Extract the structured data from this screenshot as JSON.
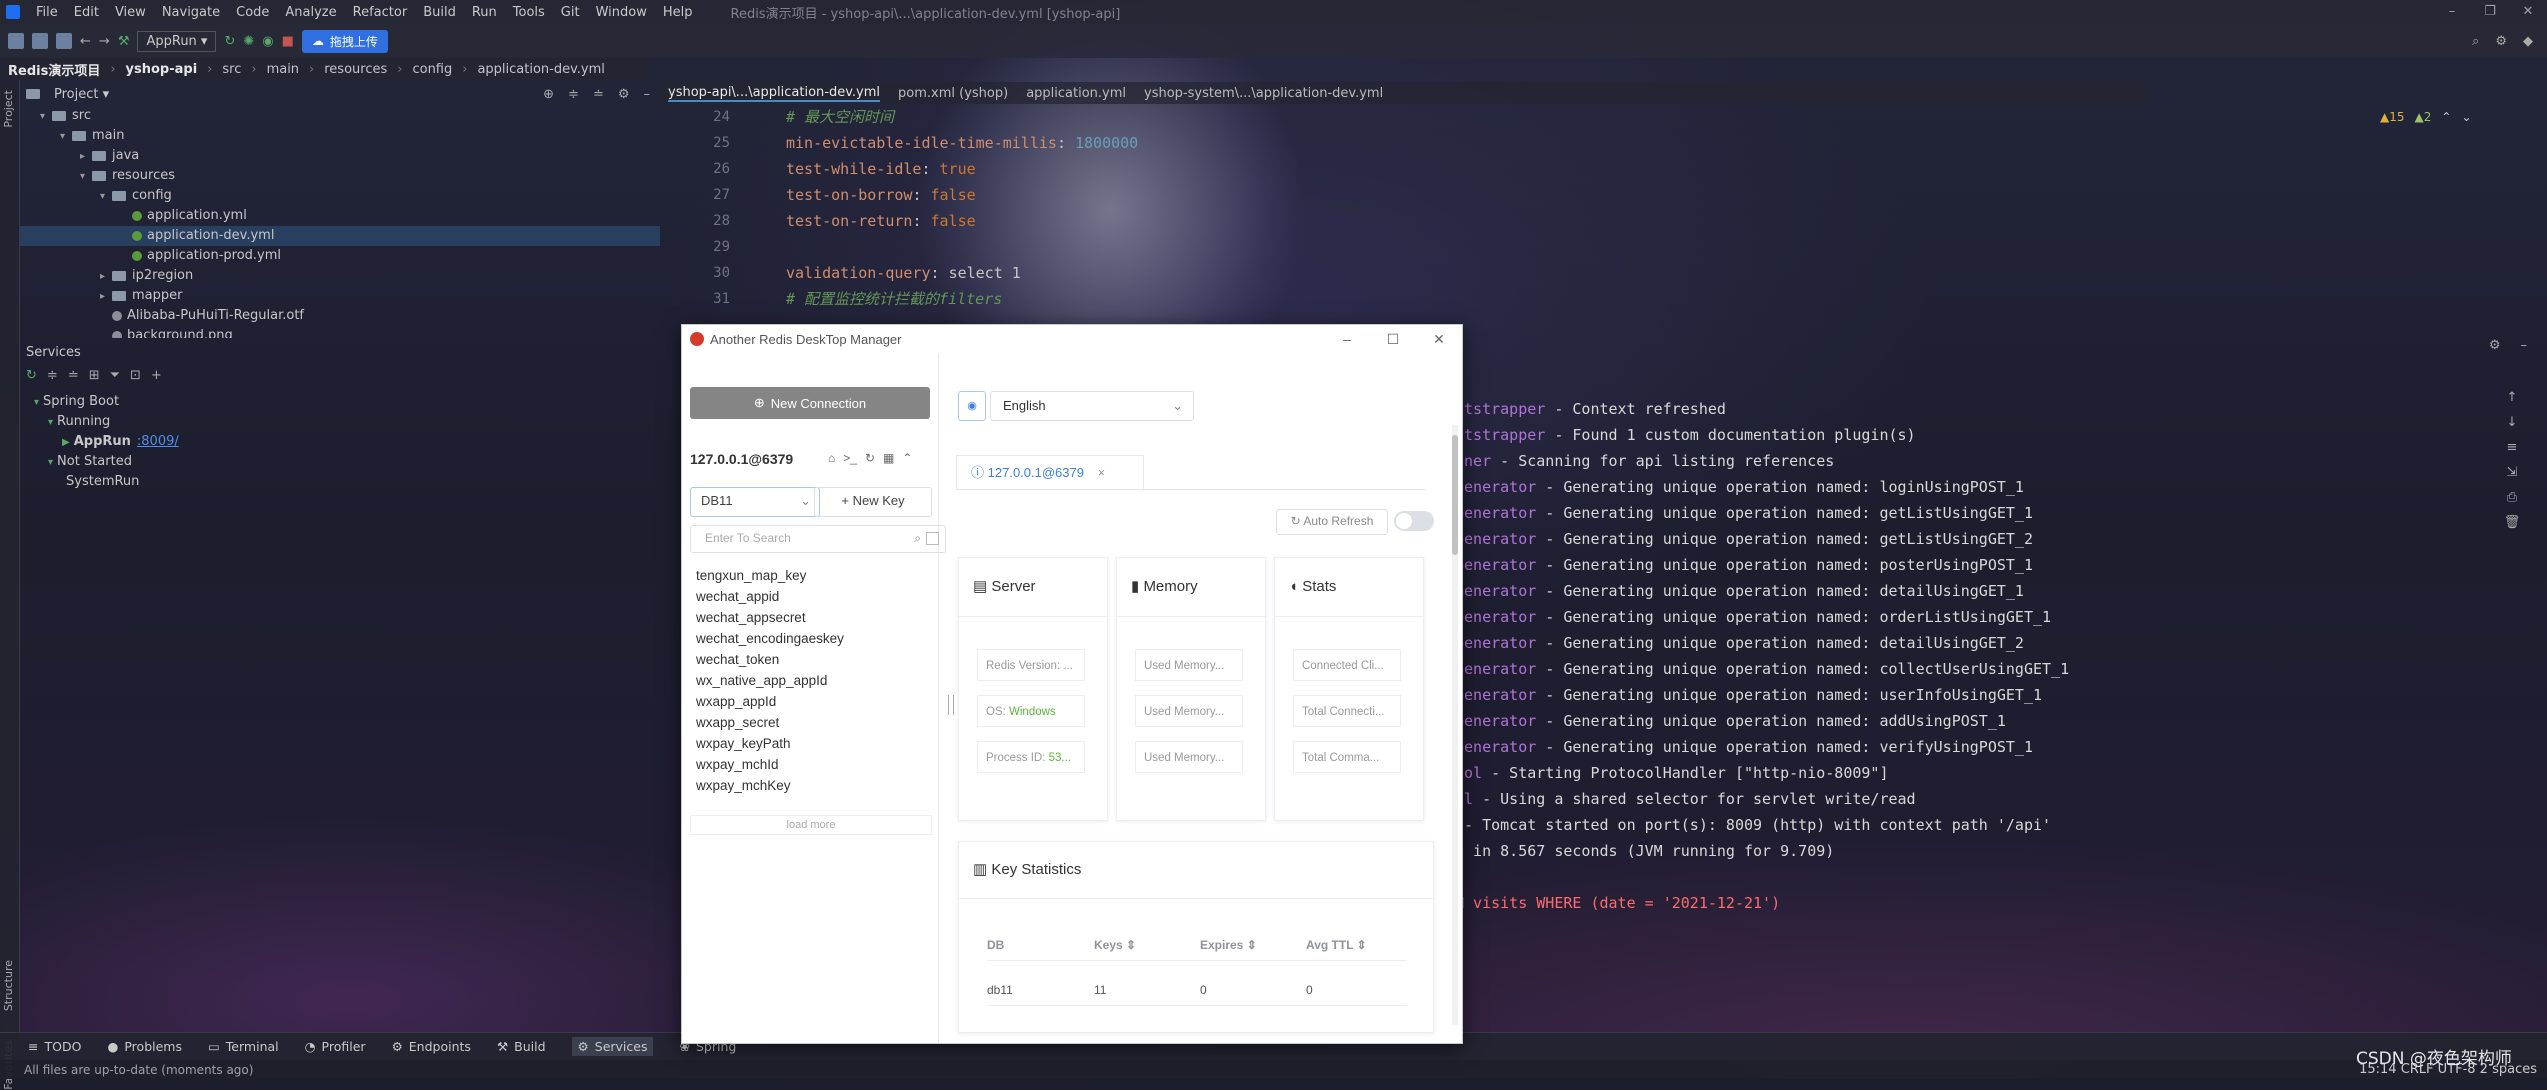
{
  "menubar": {
    "items": [
      "File",
      "Edit",
      "View",
      "Navigate",
      "Code",
      "Analyze",
      "Refactor",
      "Build",
      "Run",
      "Tools",
      "Git",
      "Window",
      "Help"
    ],
    "window_title": "Redis演示项目 - yshop-api\\...\\application-dev.yml [yshop-api]"
  },
  "toolbar": {
    "run_config": "AppRun ▾",
    "upload_label": "拖拽上传"
  },
  "breadcrumb": [
    "Redis演示项目",
    "yshop-api",
    "src",
    "main",
    "resources",
    "config",
    "application-dev.yml"
  ],
  "project": {
    "title": "Project ▾",
    "tree": [
      {
        "label": "src",
        "type": "folder",
        "indent": 1,
        "arrow": "▾"
      },
      {
        "label": "main",
        "type": "folder",
        "indent": 2,
        "arrow": "▾"
      },
      {
        "label": "java",
        "type": "folder",
        "indent": 3,
        "arrow": "▸"
      },
      {
        "label": "resources",
        "type": "folder",
        "indent": 3,
        "arrow": "▾"
      },
      {
        "label": "config",
        "type": "folder",
        "indent": 4,
        "arrow": "▾"
      },
      {
        "label": "application.yml",
        "type": "yml",
        "indent": 5,
        "arrow": ""
      },
      {
        "label": "application-dev.yml",
        "type": "yml",
        "indent": 5,
        "arrow": "",
        "selected": true
      },
      {
        "label": "application-prod.yml",
        "type": "yml",
        "indent": 5,
        "arrow": ""
      },
      {
        "label": "ip2region",
        "type": "folder",
        "indent": 4,
        "arrow": "▸"
      },
      {
        "label": "mapper",
        "type": "folder",
        "indent": 4,
        "arrow": "▸"
      },
      {
        "label": "Alibaba-PuHuiTi-Regular.otf",
        "type": "font",
        "indent": 4,
        "arrow": ""
      },
      {
        "label": "background.png",
        "type": "file",
        "indent": 4,
        "arrow": ""
      }
    ]
  },
  "services": {
    "title": "Services",
    "tree": [
      {
        "label": "Spring Boot",
        "indent": 1,
        "arrow": "▾"
      },
      {
        "label": "Running",
        "indent": 2,
        "arrow": "▾"
      },
      {
        "label": "AppRun",
        "port": ":8009/",
        "indent": 3,
        "arrow": "▶"
      },
      {
        "label": "Not Started",
        "indent": 2,
        "arrow": "▾"
      },
      {
        "label": "SystemRun",
        "indent": 3,
        "arrow": ""
      }
    ]
  },
  "editor": {
    "tabs": [
      {
        "label": "yshop-api\\...\\application-dev.yml",
        "active": true
      },
      {
        "label": "pom.xml (yshop)",
        "active": false
      },
      {
        "label": "application.yml",
        "active": false
      },
      {
        "label": "yshop-system\\...\\application-dev.yml",
        "active": false
      }
    ],
    "inspection": {
      "warnings": "▲15",
      "weak": "▲2"
    },
    "lines": [
      {
        "num": "24",
        "key": "# 最大空闲时间",
        "val": "",
        "type": "comment"
      },
      {
        "num": "25",
        "key": "min-evictable-idle-time-millis",
        "val": "1800000",
        "type": "num"
      },
      {
        "num": "26",
        "key": "test-while-idle",
        "val": "true",
        "type": "bool"
      },
      {
        "num": "27",
        "key": "test-on-borrow",
        "val": "false",
        "type": "bool"
      },
      {
        "num": "28",
        "key": "test-on-return",
        "val": "false",
        "type": "bool"
      },
      {
        "num": "29",
        "key": "",
        "val": "",
        "type": "blank"
      },
      {
        "num": "30",
        "key": "validation-query",
        "val": "select 1",
        "type": "str"
      },
      {
        "num": "31",
        "key": "# 配置监控统计拦截的filters",
        "val": "",
        "type": "comment"
      }
    ]
  },
  "console": {
    "lines": [
      {
        "src": "otstrapper",
        "msg": " - Context refreshed"
      },
      {
        "src": "otstrapper",
        "msg": " - Found 1 custom documentation plugin(s)"
      },
      {
        "src": "nner",
        "msg": " - Scanning for api listing references"
      },
      {
        "src": "Generator",
        "msg": " - Generating unique operation named: loginUsingPOST_1"
      },
      {
        "src": "Generator",
        "msg": " - Generating unique operation named: getListUsingGET_1"
      },
      {
        "src": "Generator",
        "msg": " - Generating unique operation named: getListUsingGET_2"
      },
      {
        "src": "Generator",
        "msg": " - Generating unique operation named: posterUsingPOST_1"
      },
      {
        "src": "Generator",
        "msg": " - Generating unique operation named: detailUsingGET_1"
      },
      {
        "src": "Generator",
        "msg": " - Generating unique operation named: orderListUsingGET_1"
      },
      {
        "src": "Generator",
        "msg": " - Generating unique operation named: detailUsingGET_2"
      },
      {
        "src": "Generator",
        "msg": " - Generating unique operation named: collectUserUsingGET_1"
      },
      {
        "src": "Generator",
        "msg": " - Generating unique operation named: userInfoUsingGET_1"
      },
      {
        "src": "Generator",
        "msg": " - Generating unique operation named: addUsingPOST_1"
      },
      {
        "src": "Generator",
        "msg": " - Generating unique operation named: verifyUsingPOST_1"
      },
      {
        "src": "col",
        "msg": " - Starting ProtocolHandler [\"http-nio-8009\"]"
      },
      {
        "src": "ol",
        "msg": " - Using a shared selector for servlet write/read"
      },
      {
        "src": "",
        "msg": " - Tomcat started on port(s): 8009 (http) with context path '/api'"
      },
      {
        "src": "",
        "msg": "n in 8.567 seconds (JVM running for 9.709)"
      },
      {
        "src": "",
        "msg": ""
      },
      {
        "src": "",
        "msg": "M visits WHERE (date = '2021-12-21')",
        "error": true
      }
    ]
  },
  "bottom_tabs": [
    {
      "label": "TODO",
      "icon": "≡"
    },
    {
      "label": "Problems",
      "icon": "●"
    },
    {
      "label": "Terminal",
      "icon": "▭"
    },
    {
      "label": "Profiler",
      "icon": "◔"
    },
    {
      "label": "Endpoints",
      "icon": "⚙"
    },
    {
      "label": "Build",
      "icon": "⚒"
    },
    {
      "label": "Services",
      "icon": "⚙",
      "active": true
    },
    {
      "label": "Spring",
      "icon": "❀"
    }
  ],
  "statusbar": {
    "message": "All files are up-to-date (moments ago)",
    "right": "15:14  CRLF  UTF-8  2 spaces"
  },
  "watermark": "CSDN @夜色架构师",
  "rdm": {
    "title": "Another Redis DeskTop Manager",
    "new_connection": "New Connection",
    "connection_name": "127.0.0.1@6379",
    "db_select": "DB11",
    "new_key": "+ New Key",
    "search_placeholder": "Enter To Search",
    "keys": [
      "tengxun_map_key",
      "wechat_appid",
      "wechat_appsecret",
      "wechat_encodingaeskey",
      "wechat_token",
      "wx_native_app_appId",
      "wxapp_appId",
      "wxapp_secret",
      "wxpay_keyPath",
      "wxpay_mchId",
      "wxpay_mchKey"
    ],
    "load_more": "load more",
    "language": "English",
    "conn_tab": "127.0.0.1@6379",
    "auto_refresh": "Auto Refresh",
    "server": {
      "title": "Server",
      "redis_version": "Redis Version: ...",
      "os_label": "OS: ",
      "os_value": "Windows",
      "pid_label": "Process ID: ",
      "pid_value": "53..."
    },
    "memory": {
      "title": "Memory",
      "items": [
        "Used Memory...",
        "Used Memory...",
        "Used Memory..."
      ]
    },
    "stats": {
      "title": "Stats",
      "items": [
        "Connected Cli...",
        "Total Connecti...",
        "Total Comma..."
      ]
    },
    "key_statistics": {
      "title": "Key Statistics",
      "headers": [
        "DB",
        "Keys ⇕",
        "Expires ⇕",
        "Avg TTL ⇕"
      ],
      "rows": [
        [
          "db11",
          "11",
          "0",
          "0"
        ]
      ]
    }
  },
  "colors": {
    "accent": "#3a7ee6",
    "ide_bg": "#1c1e2e",
    "green_value": "#5db63c"
  }
}
